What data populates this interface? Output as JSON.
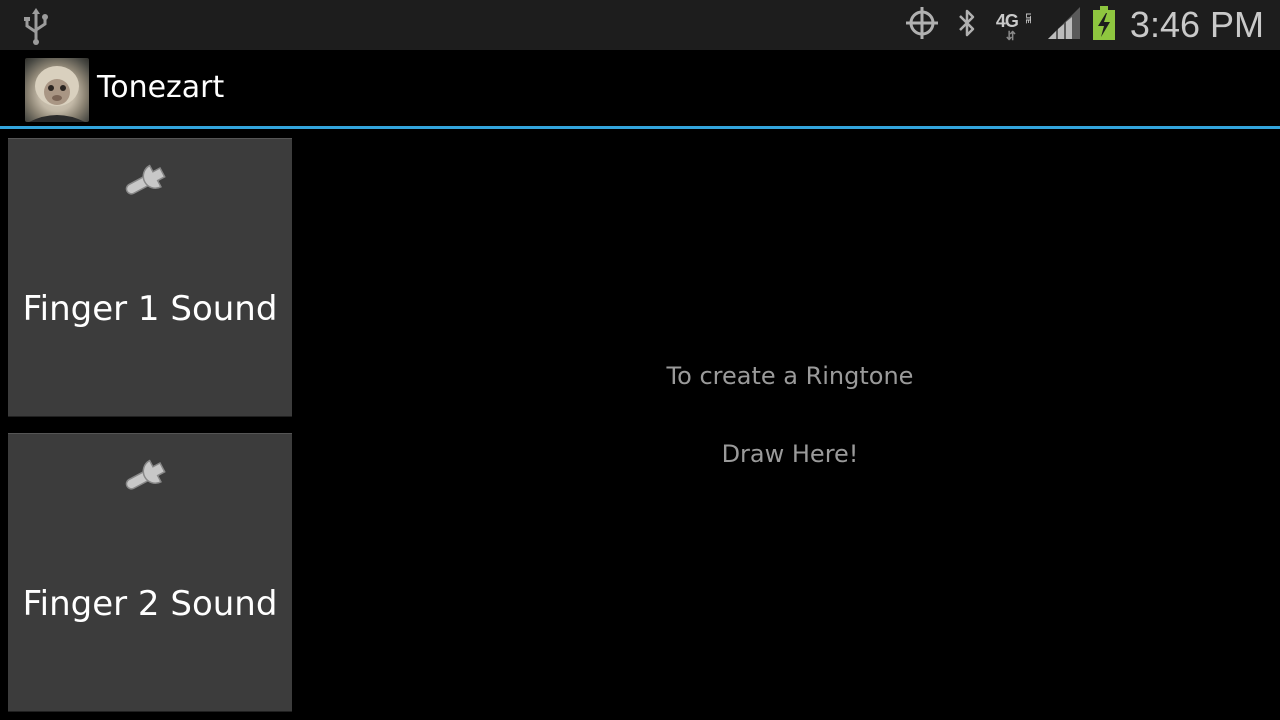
{
  "status_bar": {
    "network": "4G",
    "network_sub": "LTE",
    "time": "3:46 PM",
    "icons": [
      "usb-icon",
      "gps-icon",
      "bluetooth-icon",
      "network-4g-lte-icon",
      "signal-icon",
      "battery-charging-icon"
    ]
  },
  "action_bar": {
    "app_icon": "monkey-avatar-icon",
    "title": "Tonezart",
    "divider_color": "#33a5dd"
  },
  "buttons": [
    {
      "label": "Finger 1 Sound",
      "icon": "wrench-icon"
    },
    {
      "label": "Finger 2 Sound",
      "icon": "wrench-icon"
    }
  ],
  "draw_area": {
    "line1": "To create a Ringtone",
    "line2": "Draw Here!"
  },
  "colors": {
    "background": "#000000",
    "status_bar": "#1d1d1d",
    "button": "#3c3c3c",
    "accent": "#33a5dd",
    "battery": "#8ec63f"
  }
}
